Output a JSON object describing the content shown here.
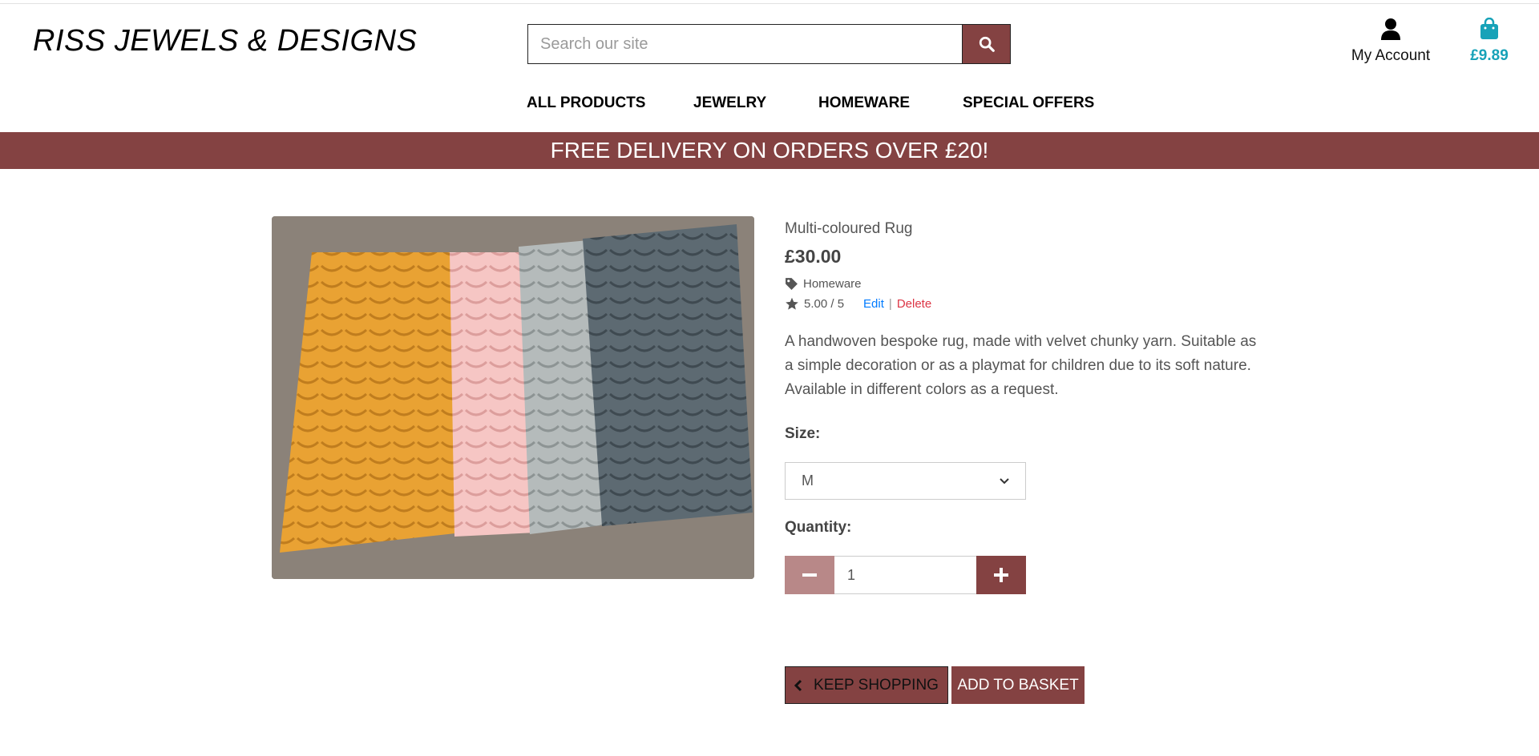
{
  "brand": "RISS JEWELS & DESIGNS",
  "search": {
    "placeholder": "Search our site"
  },
  "account": {
    "label": "My Account"
  },
  "basket": {
    "total": "£9.89"
  },
  "nav": [
    {
      "label": "ALL PRODUCTS"
    },
    {
      "label": "JEWELRY"
    },
    {
      "label": "HOMEWARE"
    },
    {
      "label": "SPECIAL OFFERS"
    }
  ],
  "banner": "FREE DELIVERY ON ORDERS OVER £20!",
  "product": {
    "name": "Multi-coloured Rug",
    "price": "£30.00",
    "category": "Homeware",
    "rating": "5.00 / 5",
    "edit": "Edit",
    "separator": "|",
    "delete": "Delete",
    "description": "A handwoven bespoke rug, made with velvet chunky yarn. Suitable as a simple decoration or as a playmat for children due to its soft nature. Available in different colors as a request."
  },
  "size": {
    "label": "Size:",
    "selected": "M"
  },
  "quantity": {
    "label": "Quantity:",
    "value": "1"
  },
  "buttons": {
    "keep_shopping": "KEEP SHOPPING",
    "add_to_basket": "ADD TO BASKET"
  },
  "colors": {
    "accent": "#844242",
    "basket": "#17a2b8",
    "minus_button": "#b88888"
  }
}
